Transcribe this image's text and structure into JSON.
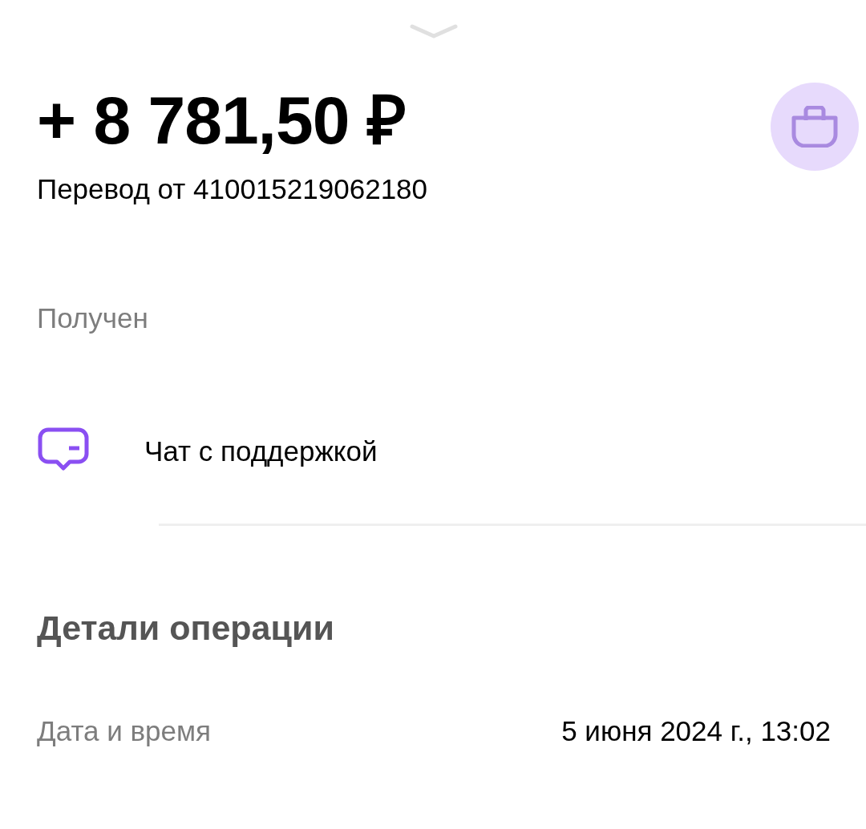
{
  "amount": "+ 8 781,50 ₽",
  "description": "Перевод от 410015219062180",
  "status": "Получен",
  "actions": [
    {
      "label": "Чат с поддержкой"
    }
  ],
  "details": {
    "title": "Детали операции",
    "rows": [
      {
        "label": "Дата и время",
        "value": "5 июня 2024 г., 13:02"
      }
    ]
  }
}
